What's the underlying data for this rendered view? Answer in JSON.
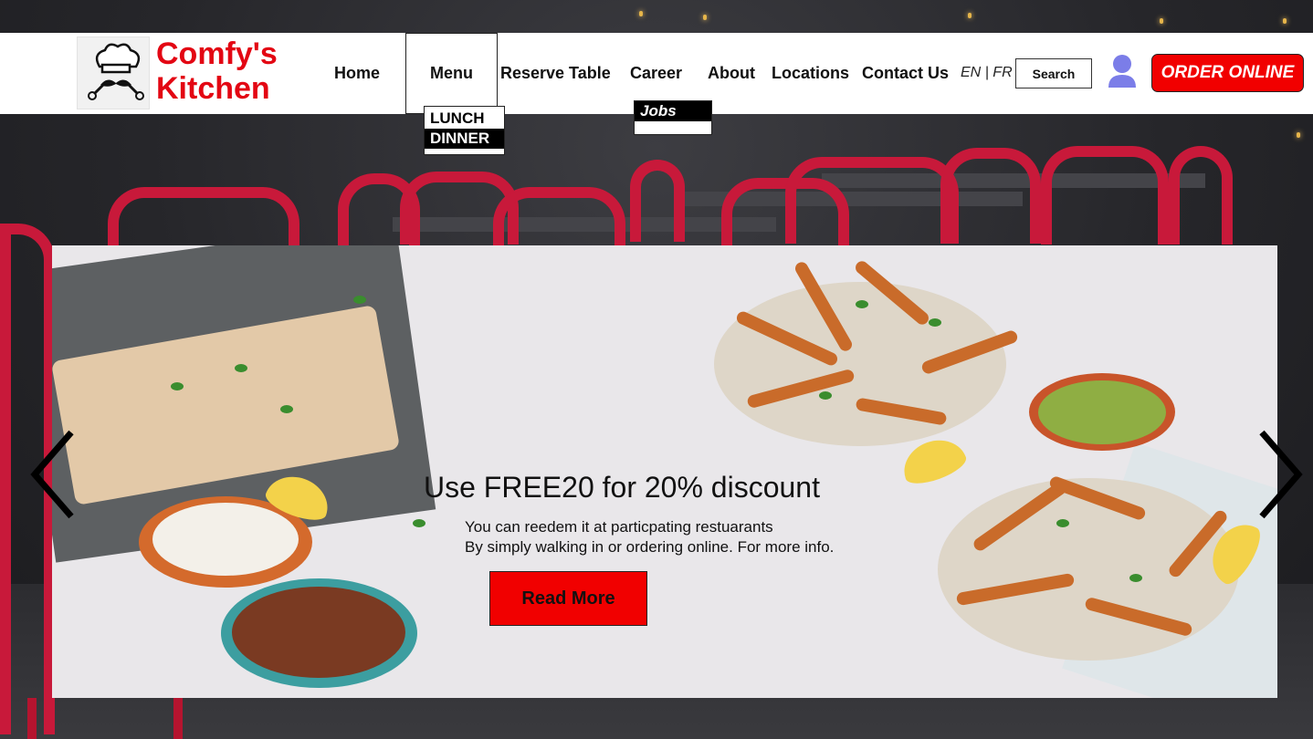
{
  "brand": {
    "name_line1": "Comfy's",
    "name_line2": "Kitchen",
    "logo_icon": "chef-mustache-icon"
  },
  "nav": {
    "home": "Home",
    "menu": "Menu",
    "reserve": "Reserve Table",
    "career": "Career",
    "about": "About",
    "locations": "Locations",
    "contact": "Contact Us"
  },
  "menu_dropdown": {
    "items": [
      "LUNCH",
      "DINNER"
    ]
  },
  "career_dropdown": {
    "items": [
      "Jobs"
    ]
  },
  "lang": {
    "en": "EN",
    "sep": "|",
    "fr": "FR"
  },
  "search": {
    "label": "Search"
  },
  "user": {
    "icon": "user-avatar-icon"
  },
  "order": {
    "label": "ORDER ONLINE"
  },
  "hero": {
    "title": "Use FREE20 for 20% discount",
    "line1": "You can reedem it at particpating restuarants",
    "line2": "By simply walking in or ordering online. For more info.",
    "button": "Read More"
  },
  "colors": {
    "accent": "#f10000",
    "brand": "#e30613"
  }
}
